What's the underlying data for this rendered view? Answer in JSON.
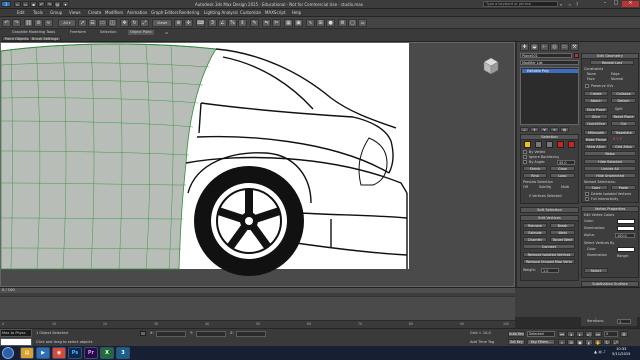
{
  "app": {
    "title": "Autodesk 3ds Max Design 2015 · Educational · Not for Commercial Use · studio.max",
    "search_placeholder": "Type a keyword or phrase"
  },
  "menu": [
    "Edit",
    "Tools",
    "Group",
    "Views",
    "Create",
    "Modifiers",
    "Animation",
    "Graph Editors",
    "Rendering",
    "Lighting Analysis",
    "Customize",
    "MAXScript",
    "Help"
  ],
  "ribbon": {
    "tabs": [
      "Graphite Modeling Tools",
      "Freeform",
      "Selection",
      "Object Paint"
    ],
    "active_tab": "Object Paint",
    "subtabs": [
      "Paint Objects",
      "Brush Settings"
    ]
  },
  "command_panel": {
    "object_name": "Plane001",
    "modifier_list": "Modifier List",
    "stack_item": "Editable Poly",
    "selection": {
      "header": "Selection",
      "by_vertex": "By Vertex",
      "ignore_backfacing": "Ignore Backfacing",
      "by_angle": "By Angle:",
      "angle_value": "45.0",
      "shrink": "Shrink",
      "grow": "Grow",
      "ring": "Ring",
      "loop": "Loop",
      "preview_selection": "Preview Selection",
      "preview_off": "Off",
      "preview_subobj": "SubObj",
      "preview_multi": "Multi",
      "status": "0 Vertices Selected"
    },
    "soft_selection": {
      "header": "Soft Selection"
    },
    "edit_vertices": {
      "header": "Edit Vertices",
      "remove": "Remove",
      "break": "Break",
      "extrude": "Extrude",
      "weld": "Weld",
      "chamfer": "Chamfer",
      "target_weld": "Target Weld",
      "connect": "Connect",
      "remove_isolated": "Remove Isolated Vertices",
      "remove_unused": "Remove Unused Map Verts",
      "weight_label": "Weight:",
      "weight_value": "1.0"
    },
    "edit_geometry": {
      "header": "Edit Geometry",
      "repeat_last": "Repeat Last",
      "constraints": "Constraints",
      "none": "None",
      "edge": "Edge",
      "face": "Face",
      "normal": "Normal",
      "preserve_uvs": "Preserve UVs",
      "create": "Create",
      "collapse": "Collapse",
      "attach": "Attach",
      "detach": "Detach",
      "slice_plane": "Slice Plane",
      "split": "Split",
      "slice": "Slice",
      "reset_plane": "Reset Plane",
      "quickslice": "QuickSlice",
      "cut": "Cut",
      "msmooth": "MSmooth",
      "tessellate": "Tessellate",
      "make_planar": "Make Planar",
      "view_align": "View Align",
      "grid_align": "Grid Align",
      "relax": "Relax",
      "hide_selected": "Hide Selected",
      "unhide_all": "Unhide All",
      "hide_unselected": "Hide Unselected",
      "named_selections": "Named Selections:",
      "copy": "Copy",
      "paste": "Paste",
      "delete_isolated": "Delete Isolated Vertices",
      "full_interactivity": "Full Interactivity"
    },
    "vertex_properties": {
      "header": "Vertex Properties",
      "edit_vertex_colors": "Edit Vertex Colors",
      "color": "Color:",
      "illumination": "Illumination:",
      "alpha": "Alpha:",
      "alpha_value": "100.0",
      "select_by": "Select Vertices By",
      "color_opt": "Color",
      "illum_opt": "Illumination",
      "range": "Range:",
      "select_btn": "Select"
    },
    "subdivision": {
      "header": "Subdivision Surface",
      "smooth_result": "Smooth Result",
      "use_nurms": "Use NURMS Subdivision",
      "isoline": "Isoline Display",
      "show_cage": "Show Cage......",
      "display": "Display",
      "iterations": "Iterations:",
      "iter_value": "1"
    }
  },
  "timeline": {
    "slider_label": "0 / 100",
    "ticks": [
      "0",
      "10",
      "20",
      "30",
      "40",
      "50",
      "60",
      "70",
      "80",
      "90",
      "100"
    ]
  },
  "status": {
    "maxscript": "Max to Physc",
    "selected": "1 Object Selected",
    "prompt": "Click and drag to select objects",
    "x": "X:",
    "y": "Y:",
    "z": "Z:",
    "grid": "Grid = 10.0",
    "auto_key": "Auto Key",
    "selected_dropdown": "Selected",
    "set_key": "Set Key",
    "key_filters": "Key Filters...",
    "add_time_tag": "Add Time Tag",
    "frame": "0"
  },
  "taskbar": {
    "apps": [
      "folder",
      "media",
      "chrome",
      "ps",
      "pr",
      "excel",
      "max"
    ],
    "time": "10:33",
    "date": "5/11/2015"
  }
}
